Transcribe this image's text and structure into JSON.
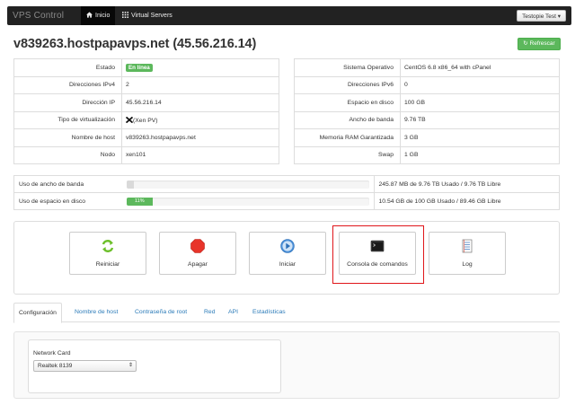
{
  "navbar": {
    "brand": "VPS Control",
    "items": [
      {
        "label": "Inicio",
        "icon": "home-icon"
      },
      {
        "label": "Virtual Servers",
        "icon": "grid-icon"
      }
    ],
    "user_menu": "Testopie Test"
  },
  "header": {
    "title": "v839263.hostpapavps.net (45.56.216.14)",
    "refresh_label": "Refrescar"
  },
  "info_left": [
    {
      "label": "Estado",
      "value": "En línea"
    },
    {
      "label": "Direcciones IPv4",
      "value": "2"
    },
    {
      "label": "Dirección IP",
      "value": "45.56.216.14"
    },
    {
      "label": "Tipo de virtualización",
      "value": "(Xen PV)"
    },
    {
      "label": "Nombre de host",
      "value": "v839263.hostpapavps.net"
    },
    {
      "label": "Nodo",
      "value": "xen101"
    }
  ],
  "info_right": [
    {
      "label": "Sistema Operativo",
      "value": "CentOS 6.8 x86_64 with cPanel"
    },
    {
      "label": "Direcciones IPv6",
      "value": "0"
    },
    {
      "label": "Espacio en disco",
      "value": "100 GB"
    },
    {
      "label": "Ancho de banda",
      "value": "9.76 TB"
    },
    {
      "label": "Memoria RAM Garantizada",
      "value": "3 GB"
    },
    {
      "label": "Swap",
      "value": "1 GB"
    }
  ],
  "usage": [
    {
      "label": "Uso de ancho de banda",
      "percent": 3,
      "bar_text": "",
      "value": "245.87 MB de 9.76 TB Usado / 9.76 TB Libre"
    },
    {
      "label": "Uso de espacio en disco",
      "percent": 11,
      "bar_text": "11%",
      "value": "10.54 GB de 100 GB Usado / 89.46 GB Libre"
    }
  ],
  "actions": [
    {
      "label": "Reiniciar",
      "icon": "restart-icon"
    },
    {
      "label": "Apagar",
      "icon": "stop-icon"
    },
    {
      "label": "Iniciar",
      "icon": "play-icon"
    },
    {
      "label": "Consola de comandos",
      "icon": "terminal-icon"
    },
    {
      "label": "Log",
      "icon": "log-icon"
    }
  ],
  "tabs": [
    "Configuración",
    "Nombre de host",
    "Contraseña de root",
    "Red",
    "API",
    "Estadísticas"
  ],
  "config": {
    "network_card_label": "Network Card",
    "network_card_value": "Realtek 8139"
  },
  "colors": {
    "accent": "#2a7ab8",
    "success": "#5cb85c",
    "highlight": "#e0161a"
  }
}
